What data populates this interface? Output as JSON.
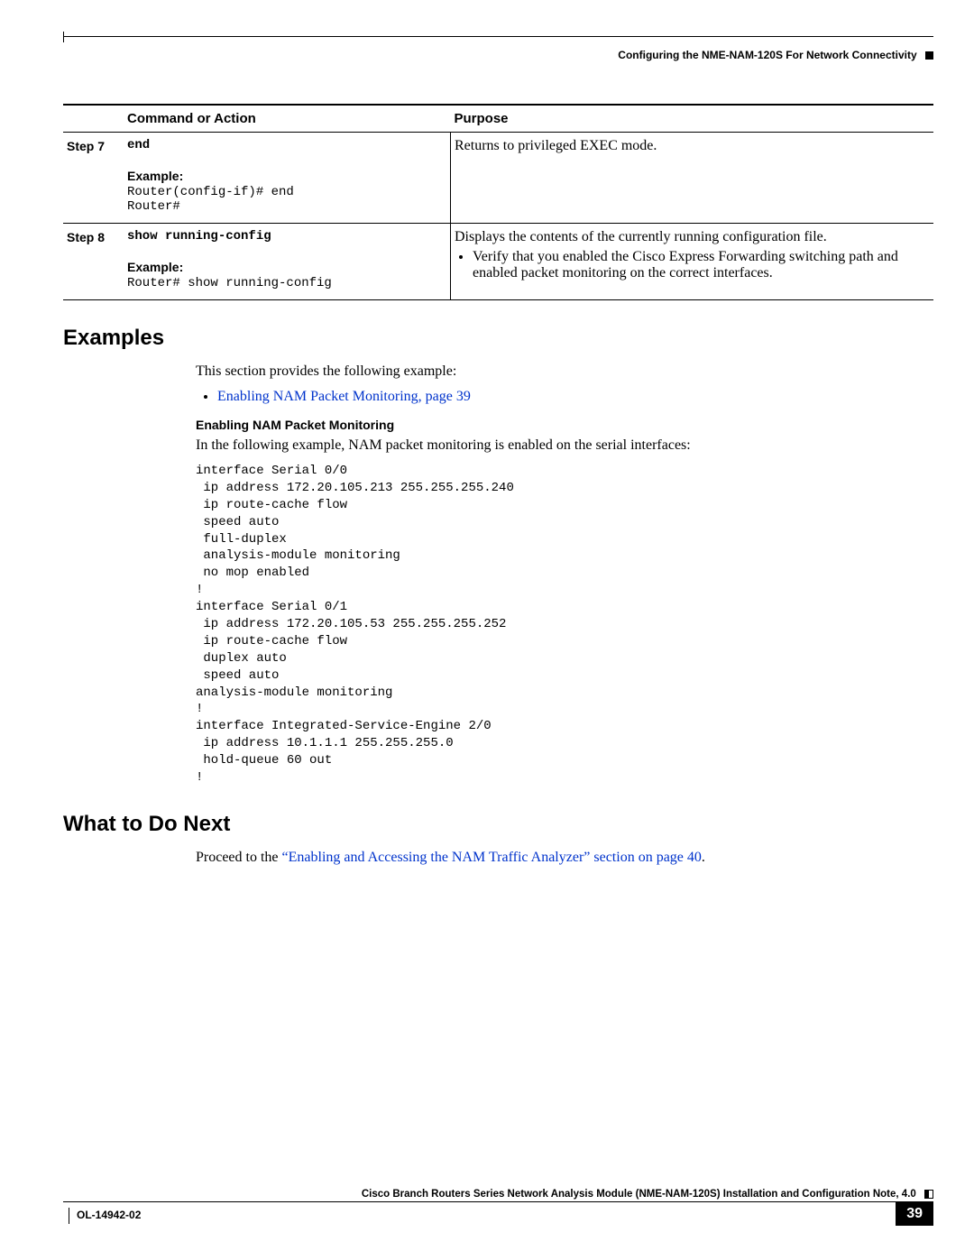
{
  "header": {
    "section_title": "Configuring the NME-NAM-120S For Network Connectivity"
  },
  "table": {
    "col1_blank": "",
    "col2": "Command or Action",
    "col3": "Purpose",
    "rows": [
      {
        "step": "Step 7",
        "command": "end",
        "example_label": "Example:",
        "example_lines": "Router(config-if)# end\nRouter#",
        "purpose_text": "Returns to privileged EXEC mode."
      },
      {
        "step": "Step 8",
        "command": "show running-config",
        "example_label": "Example:",
        "example_lines": "Router# show running-config",
        "purpose_text": "Displays the contents of the currently running configuration file.",
        "bullet": "Verify that you enabled the Cisco Express Forwarding switching path and enabled packet monitoring on the correct interfaces."
      }
    ]
  },
  "examples": {
    "heading": "Examples",
    "intro": "This section provides the following example:",
    "link": "Enabling NAM Packet Monitoring, page 39",
    "subheading": "Enabling NAM Packet Monitoring",
    "desc": "In the following example, NAM packet monitoring is enabled on the serial interfaces:",
    "code": "interface Serial 0/0\n ip address 172.20.105.213 255.255.255.240\n ip route-cache flow\n speed auto\n full-duplex\n analysis-module monitoring\n no mop enabled\n!\ninterface Serial 0/1\n ip address 172.20.105.53 255.255.255.252\n ip route-cache flow\n duplex auto\n speed auto\nanalysis-module monitoring\n!\ninterface Integrated-Service-Engine 2/0\n ip address 10.1.1.1 255.255.255.0\n hold-queue 60 out\n!"
  },
  "whatnext": {
    "heading": "What to Do Next",
    "pre": "Proceed to the ",
    "link": "“Enabling and Accessing the NAM Traffic Analyzer” section on page 40",
    "post": "."
  },
  "footer": {
    "booktitle": "Cisco Branch Routers Series Network Analysis Module (NME-NAM-120S) Installation and Configuration Note, 4.0",
    "docnum": "OL-14942-02",
    "page": "39"
  }
}
